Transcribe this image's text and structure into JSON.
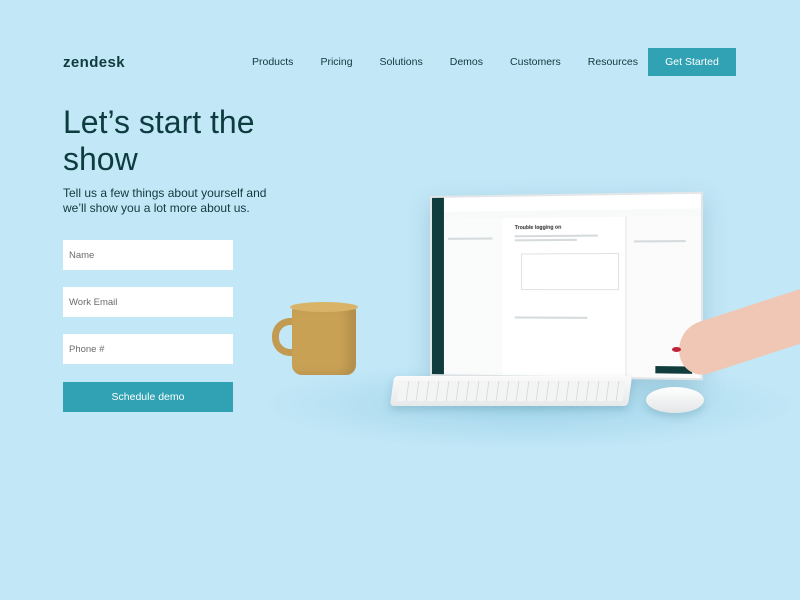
{
  "header": {
    "logo": "zendesk",
    "nav": [
      "Products",
      "Pricing",
      "Solutions",
      "Demos",
      "Customers",
      "Resources"
    ],
    "cta_label": "Get Started"
  },
  "hero": {
    "title": "Let’s start the show",
    "subtitle": "Tell us a few things about yourself and we’ll show you a lot more about us."
  },
  "form": {
    "name_placeholder": "Name",
    "email_placeholder": "Work Email",
    "phone_placeholder": "Phone #",
    "submit_label": "Schedule demo"
  },
  "illustration": {
    "ticket_title": "Trouble logging on"
  },
  "colors": {
    "background": "#c2e7f7",
    "accent": "#30a2b4",
    "text": "#0f3b3d"
  }
}
